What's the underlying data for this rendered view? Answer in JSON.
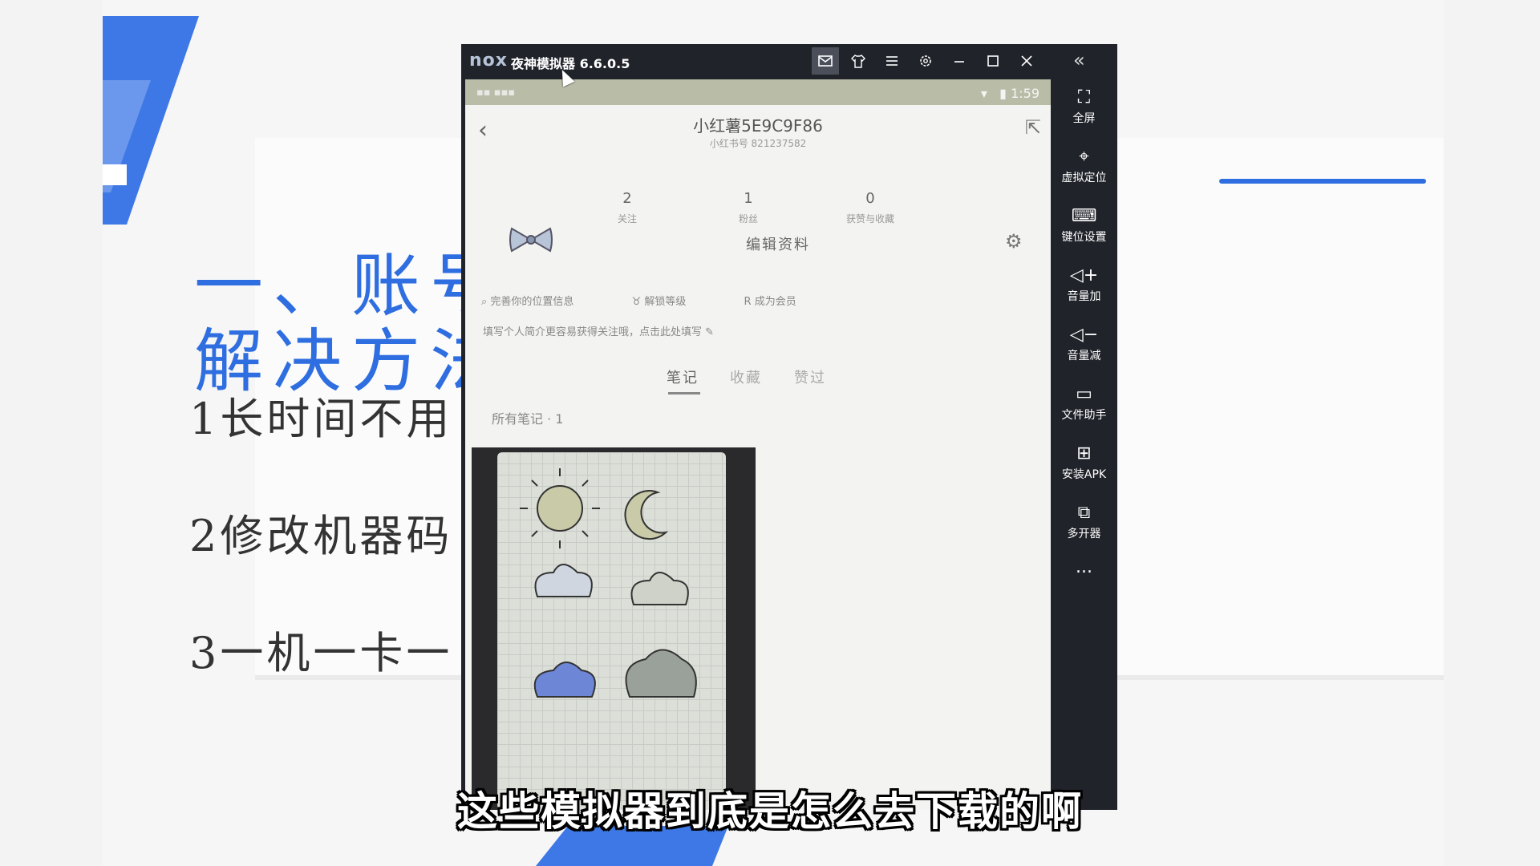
{
  "slide": {
    "title_line1": "一、账号",
    "title_line2": "解决方法",
    "items": [
      "1长时间不用",
      "2修改机器码",
      "3一机一卡一"
    ]
  },
  "emulator": {
    "logo": "nox",
    "title": "夜神模拟器 6.6.0.5",
    "titlebar_buttons": [
      "mail-icon",
      "shirt-icon",
      "menu-icon",
      "gear-icon",
      "minimize-icon",
      "maximize-icon",
      "close-icon"
    ],
    "status_time": "1:59",
    "sidebar": {
      "collapse_icon": "double-chevron-left-icon",
      "items": [
        {
          "label": "全屏",
          "icon": "fullscreen-icon"
        },
        {
          "label": "虚拟定位",
          "icon": "location-icon"
        },
        {
          "label": "键位设置",
          "icon": "keyboard-icon"
        },
        {
          "label": "音量加",
          "icon": "volume-up-icon"
        },
        {
          "label": "音量减",
          "icon": "volume-down-icon"
        },
        {
          "label": "文件助手",
          "icon": "monitor-icon"
        },
        {
          "label": "安装APK",
          "icon": "install-apk-icon"
        },
        {
          "label": "多开器",
          "icon": "multi-instance-icon"
        },
        {
          "label": "...",
          "icon": "more-icon"
        }
      ]
    }
  },
  "profile": {
    "name": "小红薯5E9C9F86",
    "id_line": "小红书号  821237582",
    "stats": [
      {
        "value": "2",
        "label": "关注"
      },
      {
        "value": "1",
        "label": "粉丝"
      },
      {
        "value": "0",
        "label": "获赞与收藏"
      }
    ],
    "edit_label": "编辑资料",
    "chips": [
      "完善你的位置信息",
      "解锁等级",
      "成为会员"
    ],
    "bio_prompt": "填写个人简介更容易获得关注哦，点击此处填写",
    "tabs": [
      "笔记",
      "收藏",
      "赞过"
    ],
    "active_tab": "笔记",
    "all_notes": "所有笔记 · 1"
  },
  "subtitle": "这些模拟器到底是怎么去下载的啊"
}
